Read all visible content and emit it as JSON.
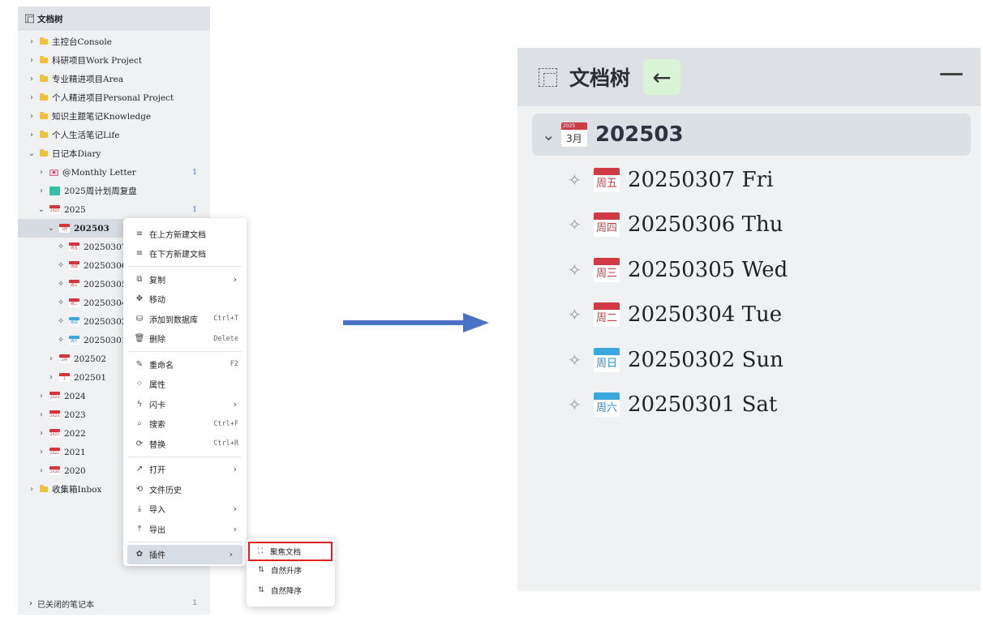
{
  "left": {
    "header_title": "文档树",
    "items": [
      {
        "label": "主控台Console",
        "arrow": "›",
        "icon": "folder",
        "indent": 0
      },
      {
        "label": "科研项目Work Project",
        "arrow": "›",
        "icon": "folder",
        "indent": 0
      },
      {
        "label": "专业精进项目Area",
        "arrow": "›",
        "icon": "folder",
        "indent": 0
      },
      {
        "label": "个人精进项目Personal Project",
        "arrow": "›",
        "icon": "folder",
        "indent": 0
      },
      {
        "label": "知识主题笔记Knowledge",
        "arrow": "›",
        "icon": "folder",
        "indent": 0
      },
      {
        "label": "个人生活笔记Life",
        "arrow": "›",
        "icon": "folder",
        "indent": 0
      },
      {
        "label": "日记本Diary",
        "arrow": "⌄",
        "icon": "folder",
        "indent": 0
      },
      {
        "label": "@Monthly Letter",
        "arrow": "›",
        "icon": "letter",
        "indent": 1,
        "count": "1"
      },
      {
        "label": "2025周计划周复盘",
        "arrow": "›",
        "icon": "teal",
        "indent": 1
      },
      {
        "label": "2025",
        "arrow": "⌄",
        "icon": "cal-red",
        "icon_text": "2025",
        "indent": 1,
        "count": "1"
      },
      {
        "label": "202503",
        "arrow": "⌄",
        "icon": "cal-red",
        "icon_text": "3月",
        "indent": 2,
        "selected": true
      },
      {
        "label": "20250307",
        "arrow": "✧",
        "icon": "cal-red",
        "icon_text": "周五",
        "indent": 3
      },
      {
        "label": "20250306",
        "arrow": "✧",
        "icon": "cal-red",
        "icon_text": "周四",
        "indent": 3
      },
      {
        "label": "20250305",
        "arrow": "✧",
        "icon": "cal-red",
        "icon_text": "周三",
        "indent": 3
      },
      {
        "label": "20250304",
        "arrow": "✧",
        "icon": "cal-red",
        "icon_text": "周二",
        "indent": 3
      },
      {
        "label": "20250302",
        "arrow": "✧",
        "icon": "cal-blue",
        "icon_text": "周日",
        "indent": 3
      },
      {
        "label": "20250301",
        "arrow": "✧",
        "icon": "cal-blue",
        "icon_text": "周六",
        "indent": 3
      },
      {
        "label": "202502",
        "arrow": "›",
        "icon": "cal-red",
        "icon_text": "2月",
        "indent": 2
      },
      {
        "label": "202501",
        "arrow": "›",
        "icon": "cal-red",
        "icon_text": "1",
        "indent": 2
      },
      {
        "label": "2024",
        "arrow": "›",
        "icon": "cal-red",
        "icon_text": "2024",
        "indent": 1
      },
      {
        "label": "2023",
        "arrow": "›",
        "icon": "cal-red",
        "icon_text": "2023",
        "indent": 1
      },
      {
        "label": "2022",
        "arrow": "›",
        "icon": "cal-red",
        "icon_text": "2022",
        "indent": 1
      },
      {
        "label": "2021",
        "arrow": "›",
        "icon": "cal-red",
        "icon_text": "2021",
        "indent": 1
      },
      {
        "label": "2020",
        "arrow": "›",
        "icon": "cal-red",
        "icon_text": "2020",
        "indent": 1
      },
      {
        "label": "收集箱Inbox",
        "arrow": "›",
        "icon": "folder",
        "indent": 0
      }
    ],
    "closed_notebooks_label": "已关闭的笔记本",
    "closed_notebooks_count": "1"
  },
  "menu": {
    "items": [
      {
        "icon": "≡",
        "label": "在上方新建文档"
      },
      {
        "icon": "≡",
        "label": "在下方新建文档"
      },
      {
        "sep": true
      },
      {
        "icon": "⧉",
        "label": "复制",
        "sub": "›"
      },
      {
        "icon": "✥",
        "label": "移动"
      },
      {
        "icon": "⛁",
        "label": "添加到数据库",
        "shortcut": "Ctrl+T"
      },
      {
        "icon": "🗑",
        "label": "删除",
        "shortcut": "Delete"
      },
      {
        "sep": true
      },
      {
        "icon": "✎",
        "label": "重命名",
        "shortcut": "F2"
      },
      {
        "icon": "⁘",
        "label": "属性"
      },
      {
        "icon": "ϟ",
        "label": "闪卡",
        "sub": "›"
      },
      {
        "icon": "⌕",
        "label": "搜索",
        "shortcut": "Ctrl+F"
      },
      {
        "icon": "⟳",
        "label": "替换",
        "shortcut": "Ctrl+R"
      },
      {
        "sep": true
      },
      {
        "icon": "↗",
        "label": "打开",
        "sub": "›"
      },
      {
        "icon": "⟲",
        "label": "文件历史"
      },
      {
        "icon": "⤓",
        "label": "导入",
        "sub": "›"
      },
      {
        "icon": "⤒",
        "label": "导出",
        "sub": "›"
      },
      {
        "sep": true
      },
      {
        "icon": "✿",
        "label": "插件",
        "sub": "›",
        "active": true
      }
    ]
  },
  "submenu": {
    "items": [
      {
        "icon": "⛶",
        "label": "聚焦文档",
        "highlighted": true
      },
      {
        "icon": "⇅",
        "label": "自然升序"
      },
      {
        "icon": "⇅",
        "label": "自然降序"
      }
    ]
  },
  "arrow_color": "#4a72c4",
  "right": {
    "header_title": "文档树",
    "back_icon": "←",
    "parent": {
      "label": "202503",
      "icon_top": "2025",
      "icon_text": "3月"
    },
    "docs": [
      {
        "label": "20250307 Fri",
        "icon_text": "周五",
        "color": "red"
      },
      {
        "label": "20250306 Thu",
        "icon_text": "周四",
        "color": "red"
      },
      {
        "label": "20250305 Wed",
        "icon_text": "周三",
        "color": "red"
      },
      {
        "label": "20250304 Tue",
        "icon_text": "周二",
        "color": "red"
      },
      {
        "label": "20250302 Sun",
        "icon_text": "周日",
        "color": "blue"
      },
      {
        "label": "20250301 Sat",
        "icon_text": "周六",
        "color": "blue"
      }
    ]
  }
}
